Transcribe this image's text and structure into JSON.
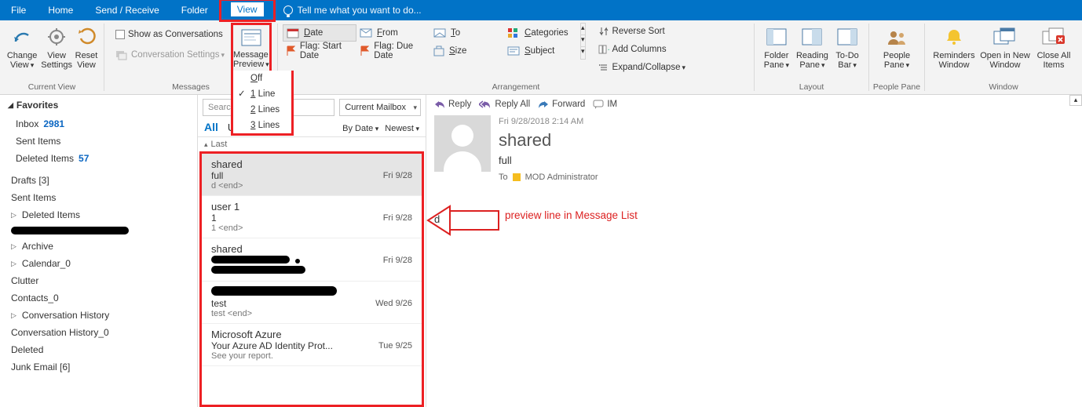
{
  "tabs": {
    "file": "File",
    "home": "Home",
    "sendreceive": "Send / Receive",
    "folder": "Folder",
    "view": "View"
  },
  "tellme": "Tell me what you want to do...",
  "ribbon": {
    "currentView": {
      "change": "Change View",
      "viewSettings": "View Settings",
      "reset": "Reset View",
      "label": "Current View"
    },
    "messages": {
      "showConv": "Show as Conversations",
      "convSettings": "Conversation Settings",
      "msgPreview": "Message Preview",
      "menu": {
        "off": "Off",
        "l1": "1 Line",
        "l2": "2 Lines",
        "l3": "3 Lines"
      },
      "label": "Messages"
    },
    "arrangement": {
      "date": "Date",
      "from": "From",
      "to": "To",
      "categories": "Categories",
      "flagStart": "Flag: Start Date",
      "flagDue": "Flag: Due Date",
      "size": "Size",
      "subject": "Subject",
      "reverse": "Reverse Sort",
      "addCols": "Add Columns",
      "expand": "Expand/Collapse",
      "label": "Arrangement"
    },
    "layout": {
      "folder": "Folder Pane",
      "reading": "Reading Pane",
      "todo": "To-Do Bar",
      "label": "Layout"
    },
    "people": {
      "people": "People Pane",
      "label": "People Pane"
    },
    "window": {
      "reminders": "Reminders Window",
      "openNew": "Open in New Window",
      "closeAll": "Close All Items",
      "label": "Window"
    }
  },
  "nav": {
    "favorites": "Favorites",
    "inbox": "Inbox",
    "inboxCount": "2981",
    "sentItems": "Sent Items",
    "deletedItems": "Deleted Items",
    "deletedCount": "57",
    "drafts": "Drafts [3]",
    "sentItems2": "Sent Items",
    "deletedItems2": "Deleted Items",
    "archive": "Archive",
    "calendar": "Calendar_0",
    "clutter": "Clutter",
    "contacts": "Contacts_0",
    "convHist": "Conversation History",
    "convHist0": "Conversation History_0",
    "deleted": "Deleted",
    "junk": "Junk Email [6]"
  },
  "search": {
    "placeholder": "Search",
    "scope": "Current Mailbox"
  },
  "filter": {
    "all": "All",
    "unread": "U",
    "byDate": "By Date",
    "newest": "Newest"
  },
  "groupHeader": "Last",
  "messagesList": [
    {
      "from": "shared",
      "subject": "full",
      "preview": "d <end>",
      "date": "Fri 9/28"
    },
    {
      "from": "user 1",
      "subject": "1",
      "preview": "1 <end>",
      "date": "Fri 9/28"
    },
    {
      "from": "shared",
      "subject": "__REDACT__",
      "preview": "__REDACT2__",
      "date": "Fri 9/28"
    },
    {
      "from": "__REDACT3__",
      "subject": "test",
      "preview": "test <end>",
      "date": "Wed 9/26"
    },
    {
      "from": "Microsoft Azure",
      "subject": "Your Azure AD Identity Prot...",
      "preview": "See your report.",
      "date": "Tue 9/25"
    }
  ],
  "read": {
    "actions": {
      "reply": "Reply",
      "replyAll": "Reply All",
      "forward": "Forward",
      "im": "IM"
    },
    "timestamp": "Fri 9/28/2018 2:14 AM",
    "from": "shared",
    "subject": "full",
    "toLabel": "To",
    "toName": "MOD Administrator",
    "body": "d"
  },
  "annotation": "preview line in Message List"
}
